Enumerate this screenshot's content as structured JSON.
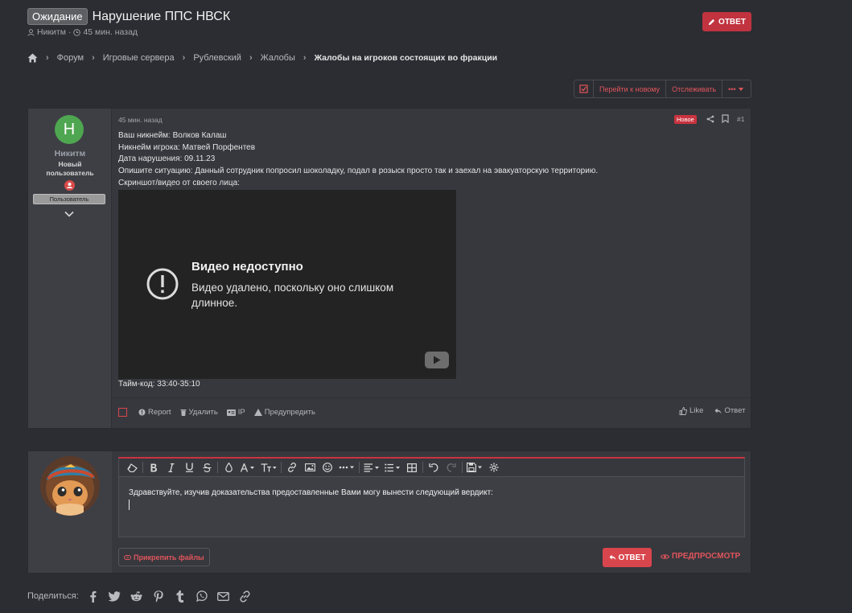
{
  "thread": {
    "prefix": "Ожидание",
    "title": "Нарушение ППС НВСК",
    "author": "Никитм",
    "time": "45 мин. назад"
  },
  "top_reply_button": "ОТВЕТ",
  "breadcrumb": [
    "Форум",
    "Игровые сервера",
    "Рублевский",
    "Жалобы",
    "Жалобы на игроков состоящих во фракции"
  ],
  "actions": {
    "go_new": "Перейти к новому",
    "watch": "Отслеживать",
    "more": "•••"
  },
  "post": {
    "avatar_letter": "Н",
    "username": "Никитм",
    "user_title_line1": "Новый",
    "user_title_line2": "пользователь",
    "user_banner": "Пользователь",
    "time": "45 мин. назад",
    "badge": "Новое",
    "number": "#1",
    "lines": [
      "Ваш никнейм: Волков Калаш",
      "Никнейм игрока: Матвей Порфентев",
      "Дата нарушения: 09.11.23",
      "Опишите ситуацию: Данный сотрудник попросил шоколадку, подал в розыск просто так и заехал на эвакуаторскую территорию.",
      "Скриншот/видео от своего лица:"
    ],
    "video": {
      "title": "Видео недоступно",
      "description": "Видео удалено, поскольку оно слишком длинное."
    },
    "timecode": "Тайм-код: 33:40-35:10",
    "controls": {
      "report": "Report",
      "delete": "Удалить",
      "ip": "IP",
      "warn": "Предупредить",
      "like": "Like",
      "reply": "Ответ"
    }
  },
  "editor": {
    "text": "Здравствуйте, изучив доказательства предоставленные Вами могу вынести следующий вердикт:",
    "attach": "Прикрепить файлы",
    "submit": "ОТВЕТ",
    "preview": "ПРЕДПРОСМОТР"
  },
  "share": {
    "label": "Поделиться:",
    "icons": [
      "facebook-icon",
      "twitter-icon",
      "reddit-icon",
      "pinterest-icon",
      "tumblr-icon",
      "whatsapp-icon",
      "email-icon",
      "link-icon"
    ]
  },
  "colors": {
    "background": "#2c2d33",
    "panel": "#37383e",
    "accent": "#c9343f",
    "avatar_green": "#4fa650"
  }
}
